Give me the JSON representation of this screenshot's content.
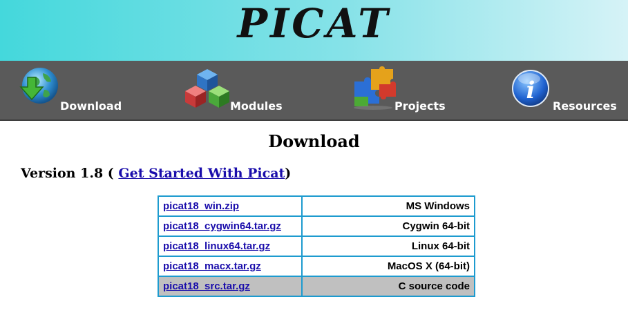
{
  "header": {
    "logo_text": "PICAT"
  },
  "nav": {
    "items": [
      {
        "label": "Download",
        "icon": "globe-download-icon"
      },
      {
        "label": "Modules",
        "icon": "cubes-icon"
      },
      {
        "label": "Projects",
        "icon": "puzzle-icon"
      },
      {
        "label": "Resources",
        "icon": "info-icon"
      }
    ]
  },
  "main": {
    "title": "Download",
    "version_prefix": "Version 1.8 (",
    "version_link": "Get Started With Picat",
    "version_suffix": ")",
    "downloads": [
      {
        "file": "picat18_win.zip",
        "platform": "MS Windows"
      },
      {
        "file": "picat18_cygwin64.tar.gz",
        "platform": "Cygwin 64-bit"
      },
      {
        "file": "picat18_linux64.tar.gz",
        "platform": "Linux 64-bit"
      },
      {
        "file": "picat18_macx.tar.gz",
        "platform": "MacOS X (64-bit)"
      },
      {
        "file": "picat18_src.tar.gz",
        "platform": "C source code"
      }
    ]
  },
  "colors": {
    "banner_start": "#44d8dc",
    "navbar": "#5a5a5a",
    "link": "#1a0dab",
    "table_border": "#1d9bcf",
    "row_highlight": "#c0c0c0"
  }
}
